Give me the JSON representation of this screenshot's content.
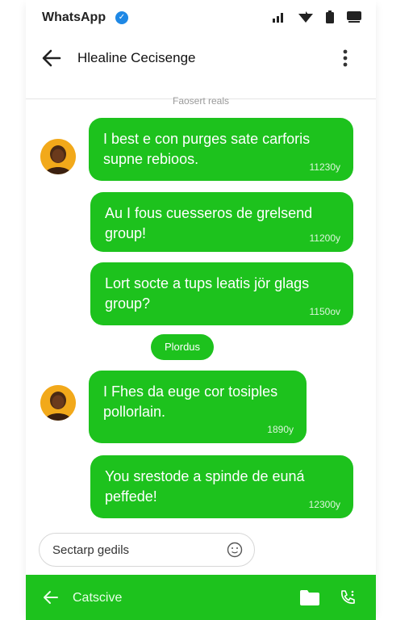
{
  "status_bar": {
    "app_name": "WhatsApp",
    "verified_glyph": "✓",
    "icons": [
      "signal-icon",
      "wifi-icon",
      "battery-icon",
      "screen-icon"
    ]
  },
  "header": {
    "title": "Hlealine Cecisenge",
    "back_icon": "back-arrow-icon",
    "menu_icon": "more-vert-icon"
  },
  "date_separator": "Faosert reals",
  "messages": [
    {
      "text": "I best e con purges sate carforis supne rebioos.",
      "time": "11230y",
      "avatar": true
    },
    {
      "text": "Au I fous cuesseros de grelsend group!",
      "time": "11200y",
      "avatar": false
    },
    {
      "text": "Lort socte a tups leatis jör glags group?",
      "time": "1150ov",
      "avatar": false
    },
    {
      "text": "I Fhes da euge cor tosiples pollorlain.",
      "time": "1890y",
      "avatar": true
    },
    {
      "text": "You srestode a spinde de euná peffede!",
      "time": "12300y",
      "avatar": false
    }
  ],
  "center_chip": "Plordus",
  "composer": {
    "placeholder_text": "Sectarp gedils",
    "emoji_icon": "smiley-icon"
  },
  "bottom_bar": {
    "label": "Catscive",
    "icons": [
      "back-arrow-icon",
      "folder-icon",
      "call-icon"
    ]
  },
  "colors": {
    "accent_green": "#1dc21d",
    "verified_blue": "#1e88e5",
    "avatar_orange": "#f2a91a"
  }
}
